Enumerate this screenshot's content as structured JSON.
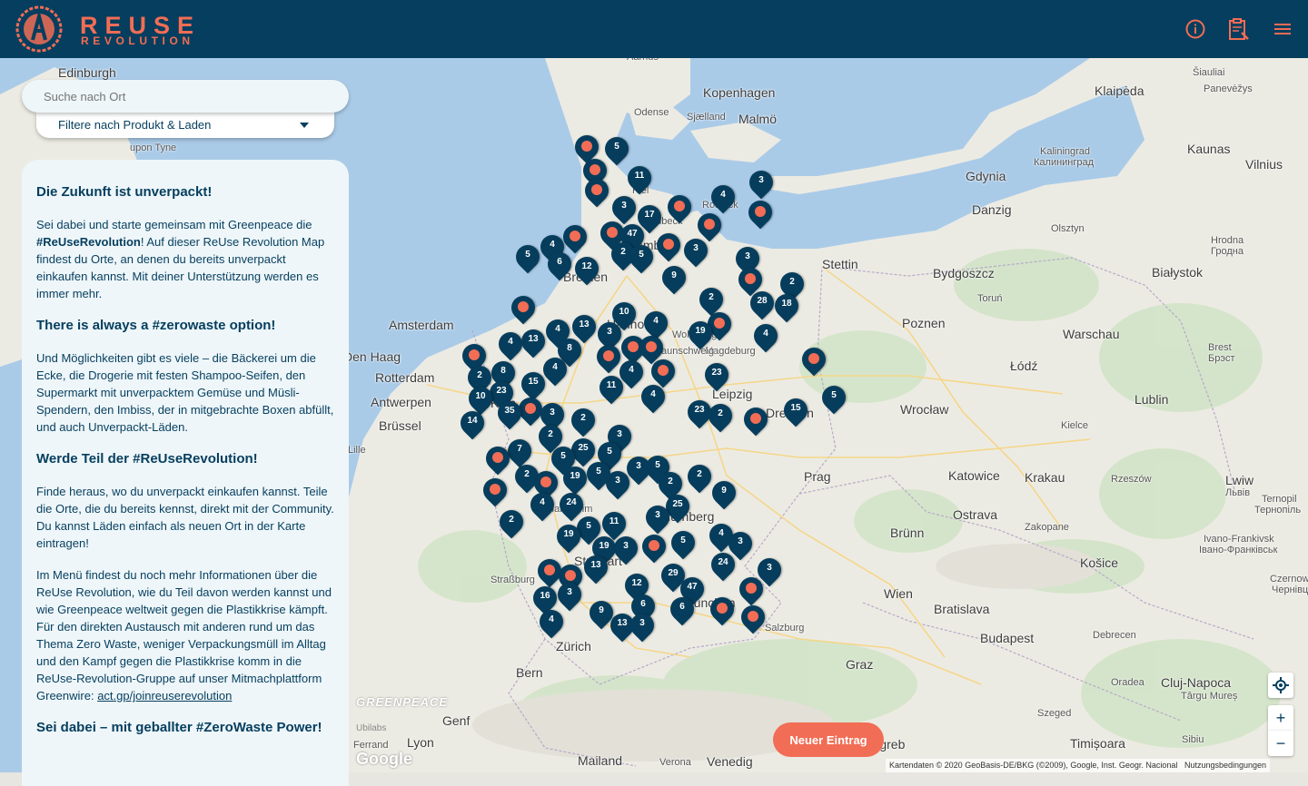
{
  "header": {
    "brand_line1": "REUSE",
    "brand_line2": "REVOLUTION",
    "icons": [
      "info-icon",
      "clipboard-icon",
      "menu-icon"
    ]
  },
  "search": {
    "placeholder": "Suche nach Ort"
  },
  "filter": {
    "label": "Filtere nach Produkt & Laden"
  },
  "panel": {
    "h1": "Die Zukunft ist unverpackt!",
    "p1_a": "Sei dabei und starte gemeinsam mit Greenpeace die ",
    "p1_b": "#ReUseRevolution",
    "p1_c": "! Auf dieser ReUse Revolution Map findest du Orte, an denen du bereits unverpackt einkaufen kannst. Mit deiner Unterstützung werden es immer mehr.",
    "h2": "There is always a #zerowaste option!",
    "p2": "Und Möglichkeiten gibt es viele – die Bäckerei um die Ecke, die Drogerie mit festen Shampoo-Seifen, den Supermarkt mit unverpacktem Gemüse und Müsli-Spendern, den Imbiss, der in mitgebrachte Boxen abfüllt, und auch Unverpackt-Läden.",
    "h3": "Werde Teil der #ReUseRevolution!",
    "p3": "Finde heraus, wo du unverpackt einkaufen kannst. Teile die Orte, die du bereits kennst, direkt mit der Community. Du kannst Läden einfach als neuen Ort in der Karte eintragen!",
    "p4": "Im Menü findest du noch mehr Informationen über die ReUse Revolution, wie du Teil davon werden kannst und wie Greenpeace weltweit gegen die Plastikkrise kämpft. Für den direkten Austausch mit anderen rund um das Thema Zero Waste, weniger Verpackungsmüll im Alltag und den Kampf gegen die Plastikkrise komm in die ReUse-Revolution-Gruppe auf unser Mitmachplattform Greenwire: ",
    "p4_link": "act.gp/joinreuserevolution",
    "h4": "Sei dabei – mit geballter #ZeroWaste Power!"
  },
  "new_entry_label": "Neuer Eintrag",
  "zoom_in": "+",
  "zoom_out": "−",
  "attribution": "Kartendaten © 2020 GeoBasis-DE/BKG (©2009), Google, Inst. Geogr. Nacional",
  "terms": "Nutzungsbedingungen",
  "greenpeace": "GREENPEACE",
  "ubilabs": "Ubilabs",
  "google": "Google",
  "cities": [
    [
      "Edinburgh",
      64,
      72,
      0
    ],
    [
      "Kopenhagen",
      774,
      94,
      0
    ],
    [
      "Malmö",
      813,
      123,
      0
    ],
    [
      "Odense",
      698,
      118,
      1
    ],
    [
      "Sjælland",
      756,
      123,
      1
    ],
    [
      "Aarhus",
      690,
      57,
      1
    ],
    [
      "Klaipėda",
      1205,
      92,
      0
    ],
    [
      "Šiauliai",
      1313,
      74,
      1
    ],
    [
      "Panevėžys",
      1325,
      92,
      1
    ],
    [
      "Kaunas",
      1307,
      156,
      0
    ],
    [
      "Vilnius",
      1371,
      173,
      0
    ],
    [
      "Kaliningrad",
      1145,
      161,
      1
    ],
    [
      "Калининград",
      1138,
      173,
      1
    ],
    [
      "Gdynia",
      1063,
      186,
      0
    ],
    [
      "Danzig",
      1070,
      223,
      0
    ],
    [
      "Olsztyn",
      1157,
      246,
      1
    ],
    [
      "Hrodna",
      1333,
      259,
      1
    ],
    [
      "Гродна",
      1333,
      271,
      1
    ],
    [
      "Białystok",
      1268,
      292,
      0
    ],
    [
      "Stettin",
      905,
      283,
      0
    ],
    [
      "Bydgoszcz",
      1027,
      293,
      0
    ],
    [
      "Toruń",
      1076,
      323,
      1
    ],
    [
      "Poznen",
      993,
      348,
      0
    ],
    [
      "Warschau",
      1170,
      360,
      0
    ],
    [
      "Brest",
      1330,
      377,
      1
    ],
    [
      "Брэст",
      1330,
      389,
      1
    ],
    [
      "Łódź",
      1112,
      395,
      0
    ],
    [
      "Amsterdam",
      428,
      350,
      0
    ],
    [
      "Den Haag",
      378,
      385,
      0
    ],
    [
      "Rotterdam",
      413,
      408,
      0
    ],
    [
      "Antwerpen",
      408,
      435,
      0
    ],
    [
      "Brüssel",
      417,
      461,
      0
    ],
    [
      "Lille",
      383,
      490,
      1
    ],
    [
      "Magdeburg",
      776,
      381,
      1
    ],
    [
      "Leipzig",
      784,
      426,
      0
    ],
    [
      "Dresden",
      843,
      447,
      0
    ],
    [
      "Wrocław",
      991,
      443,
      0
    ],
    [
      "Lublin",
      1249,
      432,
      0
    ],
    [
      "Kielce",
      1168,
      463,
      1
    ],
    [
      "Prag",
      885,
      517,
      0
    ],
    [
      "Katowice",
      1044,
      516,
      0
    ],
    [
      "Krakau",
      1128,
      518,
      0
    ],
    [
      "Rzeszów",
      1223,
      522,
      1
    ],
    [
      "Lwiw",
      1349,
      521,
      0
    ],
    [
      "Львів",
      1349,
      537,
      1
    ],
    [
      "Ternopil",
      1389,
      544,
      1
    ],
    [
      "Тернопіль",
      1381,
      556,
      1
    ],
    [
      "Ostrava",
      1049,
      559,
      0
    ],
    [
      "Zakopane",
      1128,
      575,
      1
    ],
    [
      "Brünn",
      980,
      579,
      0
    ],
    [
      "Ivano-Frankivsk",
      1325,
      588,
      1
    ],
    [
      "Івано-Франківськ",
      1320,
      600,
      1
    ],
    [
      "Košice",
      1189,
      612,
      0
    ],
    [
      "Czernow",
      1398,
      632,
      1
    ],
    [
      "Чернівц",
      1400,
      644,
      1
    ],
    [
      "Wien",
      973,
      646,
      0
    ],
    [
      "Bratislava",
      1028,
      663,
      0
    ],
    [
      "Budapest",
      1079,
      695,
      0
    ],
    [
      "Debrecen",
      1203,
      694,
      1
    ],
    [
      "Salzburg",
      842,
      686,
      1
    ],
    [
      "Zürich",
      612,
      704,
      0
    ],
    [
      "Straßburg",
      540,
      633,
      1
    ],
    [
      "Mannheim",
      601,
      555,
      1
    ],
    [
      "Bern",
      568,
      733,
      0
    ],
    [
      "Graz",
      931,
      724,
      0
    ],
    [
      "Oradea",
      1223,
      746,
      1
    ],
    [
      "Cluj-Napoca",
      1278,
      744,
      0
    ],
    [
      "Târgu Mureș",
      1300,
      761,
      1
    ],
    [
      "Szeged",
      1142,
      780,
      1
    ],
    [
      "Timișoara",
      1178,
      811,
      0
    ],
    [
      "Sibiu",
      1301,
      809,
      1
    ],
    [
      "Genf",
      487,
      786,
      0
    ],
    [
      "Lyon",
      448,
      810,
      0
    ],
    [
      "Mailand",
      636,
      830,
      0
    ],
    [
      "Verona",
      726,
      834,
      1
    ],
    [
      "Venedig",
      778,
      831,
      0
    ],
    [
      "Kiel",
      696,
      204,
      1
    ],
    [
      "Rostock",
      773,
      220,
      1
    ],
    [
      "Lübeck",
      716,
      238,
      1
    ],
    [
      "Hamburg",
      690,
      262,
      0
    ],
    [
      "Bremen",
      620,
      297,
      0
    ],
    [
      "Hannover",
      668,
      349,
      0
    ],
    [
      "Braunschweig",
      717,
      381,
      1
    ],
    [
      "Wolfsburg",
      740,
      363,
      1
    ],
    [
      "Köln",
      540,
      436,
      0
    ],
    [
      "Stuttgart",
      632,
      610,
      0
    ],
    [
      "München",
      752,
      656,
      0
    ],
    [
      "Nürnberg",
      728,
      561,
      0
    ],
    [
      "upon Tyne",
      143,
      157,
      1
    ],
    [
      "Ferrand",
      389,
      815,
      1
    ],
    [
      "Zagreb",
      952,
      812,
      0
    ]
  ],
  "pins": [
    [
      646,
      162,
      ""
    ],
    [
      679,
      164,
      "5"
    ],
    [
      655,
      188,
      ""
    ],
    [
      704,
      196,
      "11"
    ],
    [
      657,
      210,
      ""
    ],
    [
      687,
      229,
      "3"
    ],
    [
      715,
      239,
      "17"
    ],
    [
      748,
      228,
      ""
    ],
    [
      796,
      217,
      "4"
    ],
    [
      838,
      201,
      "3"
    ],
    [
      837,
      234,
      ""
    ],
    [
      781,
      248,
      ""
    ],
    [
      674,
      257,
      ""
    ],
    [
      696,
      260,
      "47"
    ],
    [
      633,
      261,
      ""
    ],
    [
      608,
      272,
      "4"
    ],
    [
      686,
      280,
      "2"
    ],
    [
      706,
      283,
      "5"
    ],
    [
      736,
      270,
      ""
    ],
    [
      766,
      276,
      "3"
    ],
    [
      823,
      285,
      "3"
    ],
    [
      581,
      283,
      "5"
    ],
    [
      616,
      291,
      "6"
    ],
    [
      646,
      296,
      "12"
    ],
    [
      742,
      306,
      "9"
    ],
    [
      826,
      308,
      ""
    ],
    [
      872,
      313,
      "2"
    ],
    [
      783,
      330,
      "2"
    ],
    [
      839,
      334,
      "28"
    ],
    [
      866,
      337,
      "18"
    ],
    [
      576,
      339,
      ""
    ],
    [
      687,
      346,
      "10"
    ],
    [
      643,
      360,
      "13"
    ],
    [
      614,
      365,
      "4"
    ],
    [
      722,
      356,
      "4"
    ],
    [
      792,
      357,
      ""
    ],
    [
      771,
      367,
      "19"
    ],
    [
      843,
      370,
      "4"
    ],
    [
      671,
      368,
      "3"
    ],
    [
      562,
      379,
      "4"
    ],
    [
      587,
      376,
      "13"
    ],
    [
      627,
      386,
      "8"
    ],
    [
      697,
      383,
      ""
    ],
    [
      717,
      383,
      ""
    ],
    [
      670,
      393,
      ""
    ],
    [
      896,
      396,
      ""
    ],
    [
      522,
      392,
      ""
    ],
    [
      554,
      411,
      "8"
    ],
    [
      611,
      407,
      "4"
    ],
    [
      695,
      410,
      "4"
    ],
    [
      730,
      409,
      ""
    ],
    [
      789,
      413,
      "23"
    ],
    [
      528,
      416,
      "2"
    ],
    [
      587,
      423,
      "15"
    ],
    [
      673,
      427,
      "11"
    ],
    [
      552,
      433,
      "23"
    ],
    [
      529,
      439,
      "10"
    ],
    [
      719,
      437,
      "4"
    ],
    [
      918,
      438,
      "5"
    ],
    [
      584,
      451,
      ""
    ],
    [
      561,
      455,
      "35"
    ],
    [
      608,
      457,
      "3"
    ],
    [
      770,
      454,
      "23"
    ],
    [
      793,
      458,
      "2"
    ],
    [
      832,
      462,
      ""
    ],
    [
      876,
      452,
      "15"
    ],
    [
      642,
      463,
      "2"
    ],
    [
      520,
      466,
      "14"
    ],
    [
      606,
      481,
      "2"
    ],
    [
      682,
      481,
      "3"
    ],
    [
      572,
      497,
      "7"
    ],
    [
      642,
      496,
      "25"
    ],
    [
      620,
      505,
      "5"
    ],
    [
      548,
      505,
      ""
    ],
    [
      671,
      500,
      "5"
    ],
    [
      580,
      525,
      "2"
    ],
    [
      601,
      532,
      ""
    ],
    [
      633,
      527,
      "19"
    ],
    [
      659,
      522,
      "5"
    ],
    [
      703,
      516,
      "3"
    ],
    [
      724,
      515,
      "5"
    ],
    [
      738,
      533,
      "2"
    ],
    [
      770,
      525,
      "2"
    ],
    [
      680,
      532,
      "3"
    ],
    [
      545,
      540,
      ""
    ],
    [
      797,
      543,
      "9"
    ],
    [
      597,
      556,
      "4"
    ],
    [
      629,
      556,
      "24"
    ],
    [
      746,
      558,
      "25"
    ],
    [
      563,
      575,
      "2"
    ],
    [
      724,
      570,
      "3"
    ],
    [
      648,
      582,
      "5"
    ],
    [
      676,
      577,
      "11"
    ],
    [
      794,
      590,
      "4"
    ],
    [
      815,
      599,
      "3"
    ],
    [
      626,
      591,
      "19"
    ],
    [
      665,
      604,
      "19"
    ],
    [
      689,
      604,
      "3"
    ],
    [
      720,
      602,
      ""
    ],
    [
      752,
      598,
      "5"
    ],
    [
      605,
      629,
      ""
    ],
    [
      628,
      635,
      ""
    ],
    [
      656,
      625,
      "13"
    ],
    [
      796,
      622,
      "24"
    ],
    [
      847,
      628,
      "3"
    ],
    [
      701,
      645,
      "12"
    ],
    [
      741,
      634,
      "29"
    ],
    [
      762,
      649,
      "47"
    ],
    [
      627,
      655,
      "3"
    ],
    [
      600,
      659,
      "16"
    ],
    [
      827,
      649,
      ""
    ],
    [
      708,
      668,
      "6"
    ],
    [
      751,
      671,
      "6"
    ],
    [
      795,
      671,
      ""
    ],
    [
      662,
      675,
      "9"
    ],
    [
      607,
      685,
      "4"
    ],
    [
      685,
      689,
      "13"
    ],
    [
      707,
      689,
      "3"
    ],
    [
      829,
      680,
      ""
    ]
  ]
}
